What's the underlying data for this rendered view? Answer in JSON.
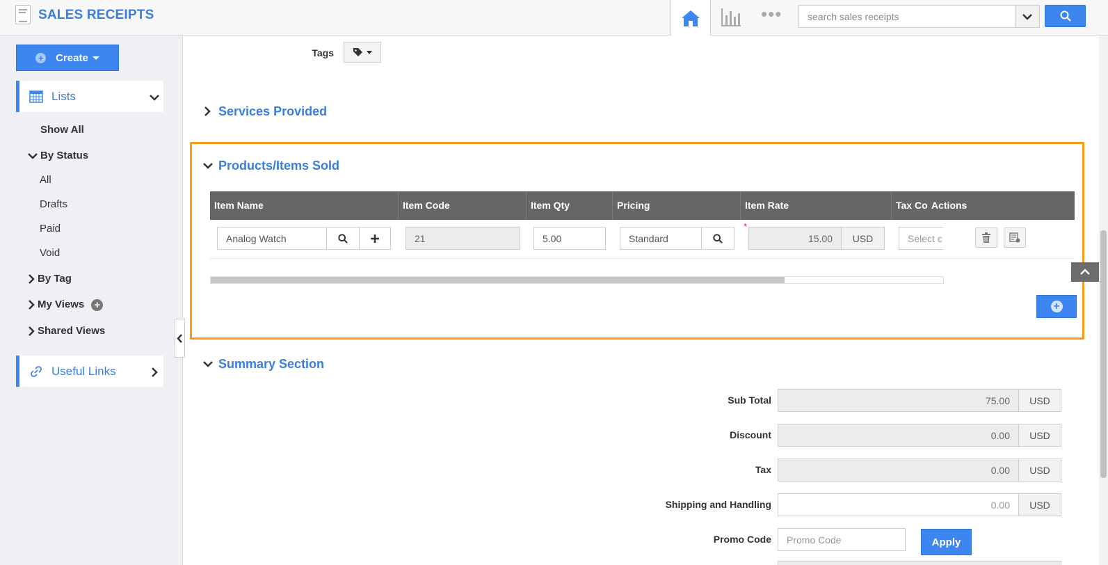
{
  "header": {
    "app_title": "SALES RECEIPTS",
    "search_placeholder": "search sales receipts",
    "more_label": "•••"
  },
  "sidebar": {
    "create_label": "Create",
    "lists_label": "Lists",
    "show_all": "Show All",
    "by_status": "By Status",
    "status_items": [
      "All",
      "Drafts",
      "Paid",
      "Void"
    ],
    "by_tag": "By Tag",
    "my_views": "My Views",
    "shared_views": "Shared Views",
    "useful_links": "Useful Links"
  },
  "form": {
    "tags_label": "Tags",
    "services_title": "Services Provided",
    "products_title": "Products/Items Sold",
    "summary_title": "Summary Section"
  },
  "items_table": {
    "columns": [
      "Item Name",
      "Item Code",
      "Item Qty",
      "Pricing",
      "Item Rate",
      "Tax Co",
      "Actions"
    ],
    "row": {
      "item_name": "Analog Watch",
      "item_code": "21",
      "item_qty": "5.00",
      "pricing": "Standard",
      "item_rate": "15.00",
      "currency": "USD",
      "tax_code_placeholder": "Select c",
      "required_marker": "*"
    }
  },
  "summary": {
    "sub_total_label": "Sub Total",
    "sub_total_value": "75.00",
    "discount_label": "Discount",
    "discount_value": "0.00",
    "tax_label": "Tax",
    "tax_value": "0.00",
    "shipping_label": "Shipping and Handling",
    "shipping_value": "0.00",
    "currency": "USD",
    "promo_label": "Promo Code",
    "promo_placeholder": "Promo Code",
    "apply_label": "Apply"
  },
  "colors": {
    "accent": "#3d86f0",
    "highlight": "#f89a12",
    "table_header": "#666666"
  },
  "icons": [
    "app-logo-icon",
    "home-icon",
    "bar-chart-icon",
    "more-icon",
    "chevron-down-icon",
    "search-icon",
    "plus-icon",
    "calendar-icon",
    "link-icon",
    "trash-icon",
    "note-icon",
    "tag-icon",
    "chevron-up-icon"
  ]
}
